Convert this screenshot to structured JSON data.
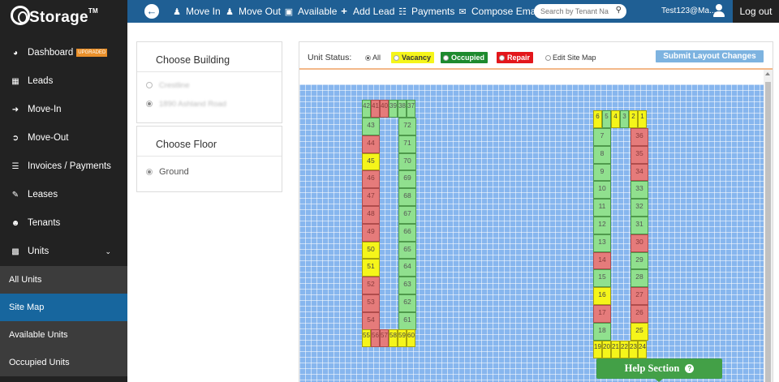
{
  "app": {
    "logo_text": "Storage",
    "logo_tm": "TM"
  },
  "topnav": {
    "items": [
      {
        "label": "Move In",
        "icon": "move-in-icon"
      },
      {
        "label": "Move Out",
        "icon": "move-out-icon"
      },
      {
        "label": "Available",
        "icon": "available-icon"
      },
      {
        "label": "Add Lead",
        "icon": "add-lead-icon"
      },
      {
        "label": "Payments",
        "icon": "payments-icon"
      },
      {
        "label": "Compose Email",
        "icon": "email-icon"
      }
    ],
    "search_placeholder": "Search by Tenant Na",
    "user": "Test123@Ma...",
    "logout": "Log out"
  },
  "sidebar": {
    "items": [
      {
        "label": "Dashboard",
        "badge": "UPGRADED"
      },
      {
        "label": "Leads"
      },
      {
        "label": "Move-In"
      },
      {
        "label": "Move-Out"
      },
      {
        "label": "Invoices / Payments"
      },
      {
        "label": "Leases"
      },
      {
        "label": "Tenants"
      },
      {
        "label": "Units"
      }
    ],
    "sub_items": [
      {
        "label": "All Units"
      },
      {
        "label": "Site Map"
      },
      {
        "label": "Available Units"
      },
      {
        "label": "Occupied Units"
      }
    ]
  },
  "building_panel": {
    "title": "Choose Building",
    "options": [
      "Crestline",
      "1890 Ashland Road"
    ]
  },
  "floor_panel": {
    "title": "Choose Floor",
    "options": [
      "Ground"
    ]
  },
  "status_bar": {
    "label": "Unit Status:",
    "all": "All",
    "vacancy": "Vacancy",
    "occupied": "Occupied",
    "repair": "Repair",
    "edit_site_map": "Edit Site Map",
    "submit": "Submit Layout Changes"
  },
  "colors": {
    "occupied": "#90e08e",
    "repair": "#e57b7b",
    "vacancy": "#f5f51a",
    "grid": "#87b6ee",
    "topbar": "#1f5f94"
  },
  "units": {
    "42": "occupied",
    "41": "repair",
    "40": "repair",
    "39": "occupied",
    "38": "occupied",
    "37": "occupied",
    "43": "occupied",
    "44": "repair",
    "45": "vacancy",
    "46": "repair",
    "47": "repair",
    "48": "repair",
    "49": "repair",
    "50": "vacancy",
    "51": "vacancy",
    "52": "repair",
    "53": "repair",
    "54": "repair",
    "72": "occupied",
    "71": "occupied",
    "70": "occupied",
    "69": "occupied",
    "68": "occupied",
    "67": "occupied",
    "66": "occupied",
    "65": "occupied",
    "64": "occupied",
    "63": "occupied",
    "62": "occupied",
    "61": "occupied",
    "55": "vacancy",
    "56": "repair",
    "57": "repair",
    "58": "vacancy",
    "59": "vacancy",
    "60": "vacancy",
    "6": "vacancy",
    "5": "occupied",
    "4": "vacancy",
    "3": "occupied",
    "2": "vacancy",
    "1": "vacancy",
    "7": "occupied",
    "8": "occupied",
    "9": "occupied",
    "10": "occupied",
    "11": "occupied",
    "12": "occupied",
    "13": "occupied",
    "14": "repair",
    "15": "occupied",
    "16": "vacancy",
    "17": "repair",
    "18": "occupied",
    "36": "repair",
    "35": "repair",
    "34": "repair",
    "33": "occupied",
    "32": "occupied",
    "31": "occupied",
    "30": "repair",
    "29": "occupied",
    "28": "occupied",
    "27": "repair",
    "26": "repair",
    "25": "vacancy",
    "19": "vacancy",
    "20": "vacancy",
    "21": "vacancy",
    "22": "vacancy",
    "23": "vacancy",
    "24": "vacancy"
  },
  "help": {
    "label": "Help Section"
  }
}
